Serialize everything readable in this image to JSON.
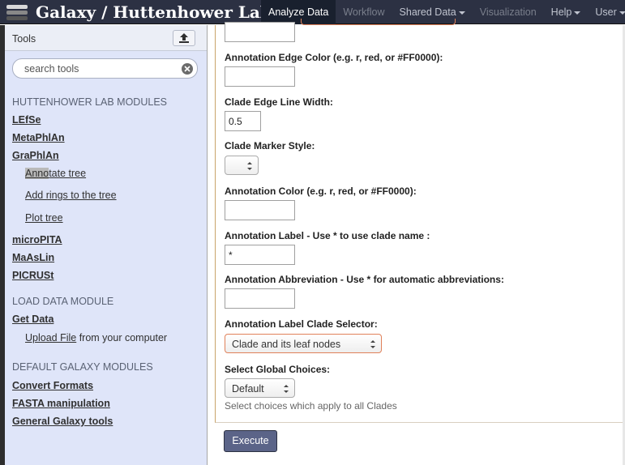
{
  "window": {
    "brand": "Galaxy / Huttenhower Lab"
  },
  "nav": {
    "tabs": [
      {
        "label": "Analyze Data",
        "dropdown": false,
        "state": "active"
      },
      {
        "label": "Workflow",
        "dropdown": false,
        "state": "disabled"
      },
      {
        "label": "Shared Data",
        "dropdown": true,
        "state": "normal"
      },
      {
        "label": "Visualization",
        "dropdown": false,
        "state": "disabled"
      },
      {
        "label": "Help",
        "dropdown": true,
        "state": "normal"
      },
      {
        "label": "User",
        "dropdown": true,
        "state": "normal"
      }
    ]
  },
  "tools": {
    "title": "Tools",
    "search_placeholder": "search tools",
    "sections": [
      {
        "title": "HUTTENHOWER LAB MODULES"
      },
      {
        "title": "LOAD DATA MODULE"
      },
      {
        "title": "DEFAULT GALAXY MODULES"
      }
    ],
    "items": {
      "lefse": "LEfSe",
      "metaphlan": "MetaPhlAn",
      "graphlan": "GraPhlAn",
      "annotate_hl": "Anno",
      "annotate_rest": "tate tree",
      "add_rings": "Add rings to the tree",
      "plot_tree": "Plot tree",
      "micropita": "microPITA",
      "maaslin": "MaAsLin",
      "picrust": "PICRUSt",
      "get_data": "Get Data",
      "upload_link": "Upload File",
      "upload_rest": " from your computer",
      "convert_formats": "Convert Formats",
      "fasta_manipulation": "FASTA manipulation",
      "general_tools": "General Galaxy tools"
    }
  },
  "form": {
    "fields": {
      "edge_color_label": "Annotation Edge Color (e.g. r, red, or #FF0000):",
      "edge_color_value": "",
      "clade_edge_width_label": "Clade Edge Line Width:",
      "clade_edge_width_value": "0.5",
      "clade_marker_style_label": "Clade Marker Style:",
      "clade_marker_style_value": "",
      "annotation_color_label": "Annotation Color (e.g. r, red, or #FF0000):",
      "annotation_color_value": "",
      "annotation_label_label": "Annotation Label - Use * to use clade name :",
      "annotation_label_value": "*",
      "annotation_abbrev_label": "Annotation Abbreviation - Use * for automatic abbreviations:",
      "annotation_abbrev_value": "",
      "clade_selector_label": "Annotation Label Clade Selector:",
      "clade_selector_value": "Clade and its leaf nodes",
      "global_choices_label": "Select Global Choices:",
      "global_choices_value": "Default",
      "global_choices_hint": "Select choices which apply to all Clades"
    },
    "execute_label": "Execute"
  },
  "colors": {
    "masthead": "#2c3143",
    "tool_panel": "#dfe5f9",
    "focus_border": "#e0815a",
    "execute_button": "#5b6488"
  }
}
